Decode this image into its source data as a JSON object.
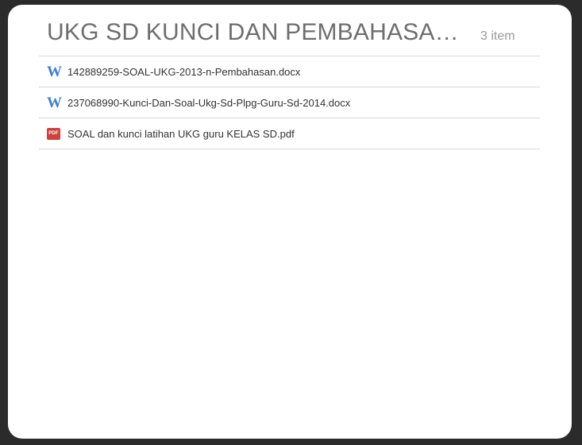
{
  "folder": {
    "title": "UKG SD KUNCI DAN PEMBAHASAN...",
    "item_count": "3 item"
  },
  "files": [
    {
      "name": "142889259-SOAL-UKG-2013-n-Pembahasan.docx",
      "icon": "word-doc-icon",
      "icon_glyph": "W"
    },
    {
      "name": "237068990-Kunci-Dan-Soal-Ukg-Sd-Plpg-Guru-Sd-2014.docx",
      "icon": "word-doc-icon",
      "icon_glyph": "W"
    },
    {
      "name": "SOAL dan kunci latihan UKG guru KELAS SD.pdf",
      "icon": "pdf-file-icon",
      "icon_glyph": "PDF"
    }
  ],
  "colors": {
    "background": "#2b2b2b",
    "card": "#ffffff",
    "title": "#6e6e6e",
    "word_icon": "#3f7fd4",
    "pdf_icon": "#d0413b",
    "divider": "#d8d8d8"
  }
}
